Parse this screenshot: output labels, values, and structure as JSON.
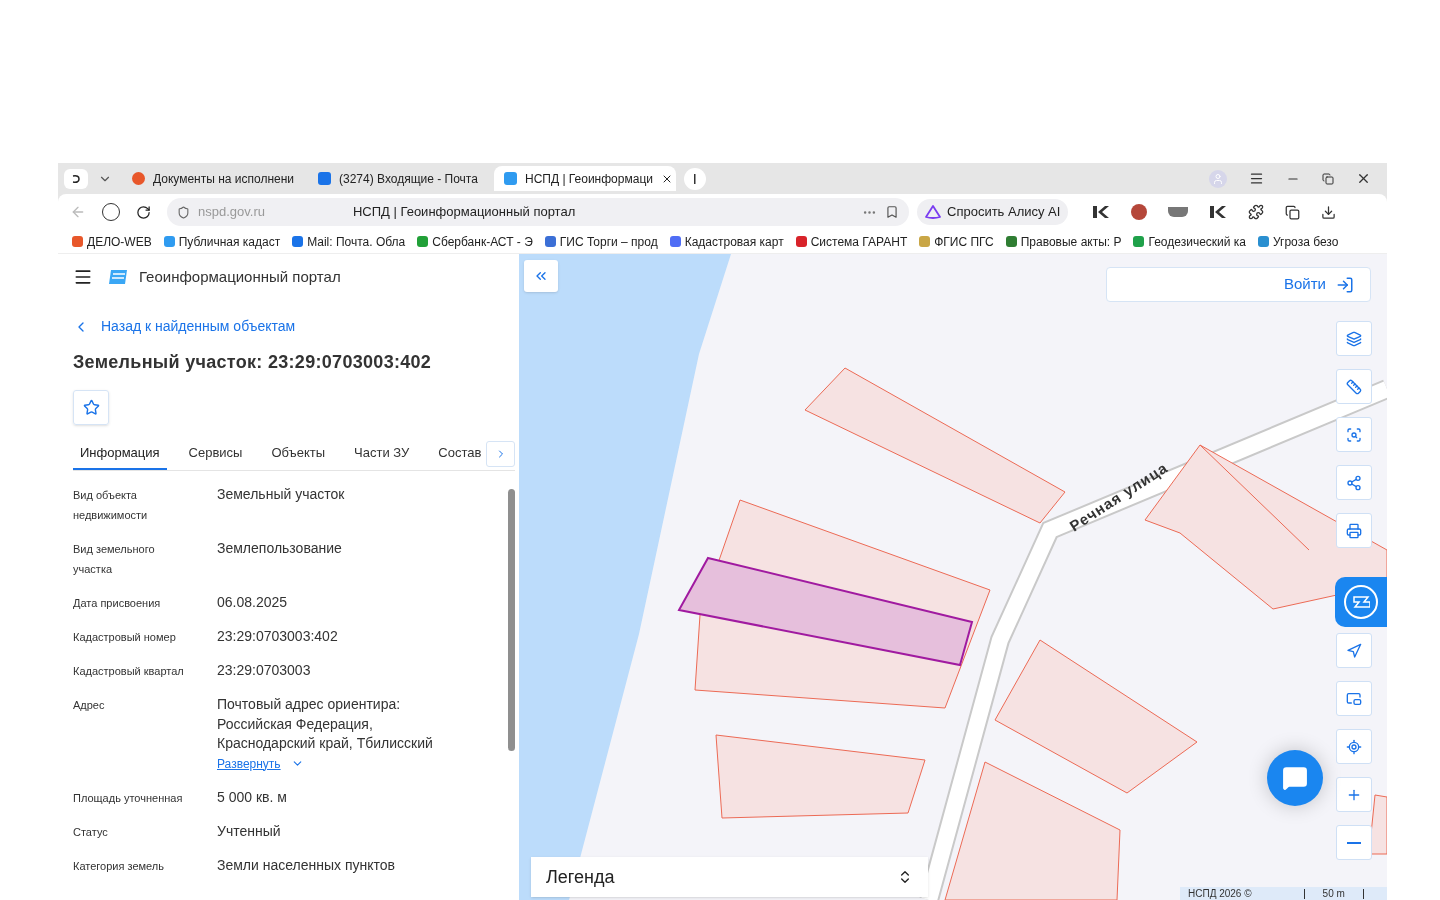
{
  "browser": {
    "tabs": [
      {
        "title": "Документы на исполнени",
        "selected": false
      },
      {
        "title": "(3274) Входящие - Почта",
        "selected": false
      },
      {
        "title": "НСПД | Геоинформаци",
        "selected": true
      }
    ],
    "url": "nspd.gov.ru",
    "page_title": "НСПД | Геоинформационный портал",
    "alice_button": "Спросить Алису AI",
    "bookmarks": [
      {
        "label": "ДЕЛО-WEB",
        "color": "#e8572a"
      },
      {
        "label": "Публичная кадаст",
        "color": "#2f9bf0"
      },
      {
        "label": "Mail: Почта. Обла",
        "color": "#1a73e8"
      },
      {
        "label": "Сбербанк-АСТ - Э",
        "color": "#21a038"
      },
      {
        "label": "ГИС Торги – прод",
        "color": "#3b6fd6"
      },
      {
        "label": "Кадастровая карт",
        "color": "#4f6df5"
      },
      {
        "label": "Система ГАРАНТ",
        "color": "#d8232a"
      },
      {
        "label": "ФГИС ПГС",
        "color": "#c9a646"
      },
      {
        "label": "Правовые акты: Р",
        "color": "#2f7d32"
      },
      {
        "label": "Геодезический ка",
        "color": "#1fa14a"
      },
      {
        "label": "Угроза безо",
        "color": "#2a8fd0"
      }
    ]
  },
  "portal": {
    "title": "Геоинформационный портал",
    "back_link": "Назад к найденным объектам",
    "object_title": "Земельный участок: 23:29:0703003:402",
    "tabs": [
      {
        "label": "Информация",
        "selected": true
      },
      {
        "label": "Сервисы",
        "selected": false
      },
      {
        "label": "Объекты",
        "selected": false
      },
      {
        "label": "Части ЗУ",
        "selected": false
      },
      {
        "label": "Состав",
        "selected": false
      }
    ],
    "fields": [
      {
        "label": "Вид объекта недвижимости",
        "value_lines": [
          "Земельный участок"
        ]
      },
      {
        "label": "Вид земельного участка",
        "value_lines": [
          "Землепользование"
        ]
      },
      {
        "label": "Дата присвоения",
        "value_lines": [
          "06.08.2025"
        ]
      },
      {
        "label": "Кадастровый номер",
        "value_lines": [
          "23:29:0703003:402"
        ]
      },
      {
        "label": "Кадастровый квартал",
        "value_lines": [
          "23:29:0703003"
        ]
      },
      {
        "label": "Адрес",
        "value_lines": [
          "Почтовый адрес ориентира:",
          "Российская Федерация,",
          "Краснодарский край, Тбилисский"
        ],
        "expand_link": "Развернуть"
      },
      {
        "label": "Площадь уточненная",
        "value_lines": [
          "5 000 кв. м"
        ]
      },
      {
        "label": "Статус",
        "value_lines": [
          "Учтенный"
        ]
      },
      {
        "label": "Категория земель",
        "value_lines": [
          "Земли населенных пунктов"
        ]
      }
    ]
  },
  "map": {
    "login_button": "Войти",
    "street_label": "Речная улица",
    "legend": "Легенда",
    "attribution": "НСПД 2026 ©",
    "scale": "50 m"
  }
}
